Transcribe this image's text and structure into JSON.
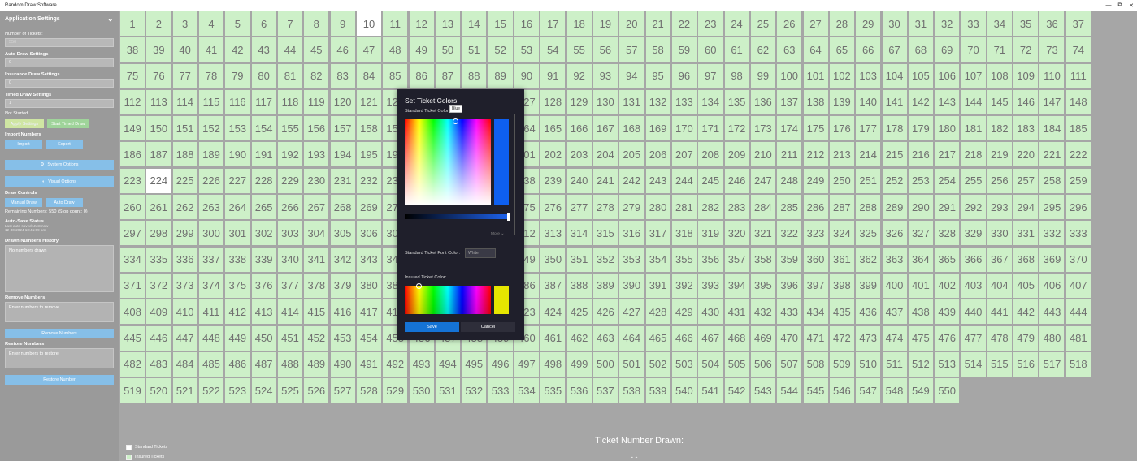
{
  "window": {
    "title": "Random Draw Software",
    "minimize_glyph": "—",
    "restore_glyph": "⧉",
    "close_glyph": "✕"
  },
  "sidebar": {
    "header": "Application Settings",
    "num_tickets_label": "Number of Tickets:",
    "num_tickets_value": "550",
    "auto_draw_label": "Auto Draw Settings",
    "auto_draw_value": "0",
    "insurance_label": "Insurance Draw Settings",
    "insurance_value": "0",
    "timed_label": "Timed Draw Settings",
    "timed_value": "1",
    "timer_status": "Not Started",
    "apply_settings": "Apply Settings",
    "start_timed_draw": "Start Timed Draw",
    "import_label": "Import Numbers",
    "import_button": "Import",
    "export_button": "Export",
    "system_options": "System Options",
    "visual_options": "Visual Options",
    "draw_controls_label": "Draw Controls",
    "manual_draw": "Manual Draw",
    "auto_draw": "Auto Draw",
    "remaining": "Remaining Numbers: 550 (Stop count: 0)",
    "autosave_label": "Auto-Save Status",
    "autosave_text": "Last auto-saved: Just now",
    "autosave_time": "12-30-2024 10:41:09 am",
    "history_label": "Drawn Numbers History",
    "history_text": "No numbers drawn",
    "remove_label": "Remove Numbers",
    "remove_placeholder": "Enter numbers to remove",
    "remove_button": "Remove Numbers",
    "restore_label": "Restore Numbers",
    "restore_placeholder": "Enter numbers to restore",
    "restore_button": "Restore Number"
  },
  "grid": {
    "total": 550,
    "drawn_numbers": [
      10,
      224
    ]
  },
  "legend": {
    "standard": "Standard Tickets",
    "insured": "Insured Tickets"
  },
  "draw_display": {
    "label": "Ticket Number Drawn:",
    "value": "- -"
  },
  "dialog": {
    "title": "Set Ticket Colors",
    "standard_color_label": "Standard Ticket Color:",
    "tooltip": "Blue",
    "more_label": "More ⌄",
    "font_color_label": "Standard Ticket Font Color:",
    "font_color_value": "White",
    "insured_color_label": "Insured Ticket Color:",
    "save": "Save",
    "cancel": "Cancel"
  },
  "colors": {
    "standard_ticket": "#cdf0c8",
    "drawn_ticket": "#ffffff",
    "standard_selected": "#0e5ff0",
    "insured_selected": "#e6e600",
    "accent": "#1573d6"
  }
}
